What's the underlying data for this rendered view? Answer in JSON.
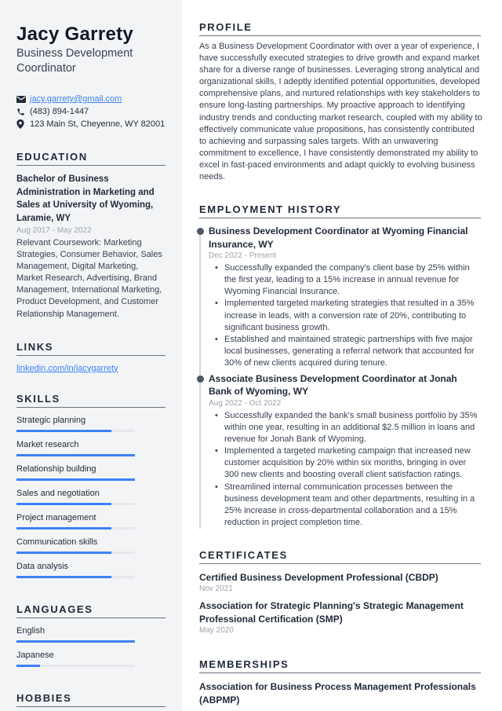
{
  "header": {
    "name": "Jacy Garrety",
    "title": "Business Development Coordinator"
  },
  "contact": {
    "email": "jacy.garrety@gmail.com",
    "phone": "(483) 894-1447",
    "address": "123 Main St, Cheyenne, WY 82001",
    "icons": {
      "email": "envelope-icon",
      "phone": "phone-icon",
      "address": "map-pin-icon"
    }
  },
  "education": {
    "heading": "EDUCATION",
    "degree": "Bachelor of Business Administration in Marketing and Sales at University of Wyoming, Laramie, WY",
    "dates": "Aug 2017 - May 2022",
    "description": "Relevant Coursework: Marketing Strategies, Consumer Behavior, Sales Management, Digital Marketing, Market Research, Advertising, Brand Management, International Marketing, Product Development, and Customer Relationship Management."
  },
  "links": {
    "heading": "LINKS",
    "items": [
      {
        "label": "linkedin.com/in/jacygarrety"
      }
    ]
  },
  "skills": {
    "heading": "SKILLS",
    "items": [
      {
        "label": "Strategic planning",
        "level": 0.8
      },
      {
        "label": "Market research",
        "level": 1.0
      },
      {
        "label": "Relationship building",
        "level": 1.0
      },
      {
        "label": "Sales and negotiation",
        "level": 0.8
      },
      {
        "label": "Project management",
        "level": 0.8
      },
      {
        "label": "Communication skills",
        "level": 0.8
      },
      {
        "label": "Data analysis",
        "level": 0.8
      }
    ]
  },
  "languages": {
    "heading": "LANGUAGES",
    "items": [
      {
        "label": "English",
        "level": 1.0
      },
      {
        "label": "Japanese",
        "level": 0.2
      }
    ]
  },
  "hobbies": {
    "heading": "HOBBIES"
  },
  "profile": {
    "heading": "PROFILE",
    "text": "As a Business Development Coordinator with over a year of experience, I have successfully executed strategies to drive growth and expand market share for a diverse range of businesses. Leveraging strong analytical and organizational skills, I adeptly identified potential opportunities, developed comprehensive plans, and nurtured relationships with key stakeholders to ensure long-lasting partnerships. My proactive approach to identifying industry trends and conducting market research, coupled with my ability to effectively communicate value propositions, has consistently contributed to achieving and surpassing sales targets. With an unwavering commitment to excellence, I have consistently demonstrated my ability to excel in fast-paced environments and adapt quickly to evolving business needs."
  },
  "employment": {
    "heading": "EMPLOYMENT HISTORY",
    "jobs": [
      {
        "title": "Business Development Coordinator at Wyoming Financial Insurance, WY",
        "dates": "Dec 2022 - Present",
        "bullets": [
          "Successfully expanded the company's client base by 25% within the first year, leading to a 15% increase in annual revenue for Wyoming Financial Insurance.",
          "Implemented targeted marketing strategies that resulted in a 35% increase in leads, with a conversion rate of 20%, contributing to significant business growth.",
          "Established and maintained strategic partnerships with five major local businesses, generating a referral network that accounted for 30% of new clients acquired during tenure."
        ]
      },
      {
        "title": "Associate Business Development Coordinator at Jonah Bank of Wyoming, WY",
        "dates": "Aug 2022 - Oct 2022",
        "bullets": [
          "Successfully expanded the bank's small business portfolio by 35% within one year, resulting in an additional $2.5 million in loans and revenue for Jonah Bank of Wyoming.",
          "Implemented a targeted marketing campaign that increased new customer acquisition by 20% within six months, bringing in over 300 new clients and boosting overall client satisfaction ratings.",
          "Streamlined internal communication processes between the business development team and other departments, resulting in a 25% increase in cross-departmental collaboration and a 15% reduction in project completion time."
        ]
      }
    ]
  },
  "certificates": {
    "heading": "CERTIFICATES",
    "items": [
      {
        "name": "Certified Business Development Professional (CBDP)",
        "date": "Nov 2021"
      },
      {
        "name": "Association for Strategic Planning's Strategic Management Professional Certification (SMP)",
        "date": "May 2020"
      }
    ]
  },
  "memberships": {
    "heading": "MEMBERSHIPS",
    "items": [
      {
        "name": "Association for Business Process Management Professionals (ABPMP)"
      }
    ]
  },
  "colors": {
    "accent": "#3b82f6",
    "sidebar_bg": "#f3f4f6",
    "text": "#1f2937",
    "muted": "#9ca3af"
  }
}
